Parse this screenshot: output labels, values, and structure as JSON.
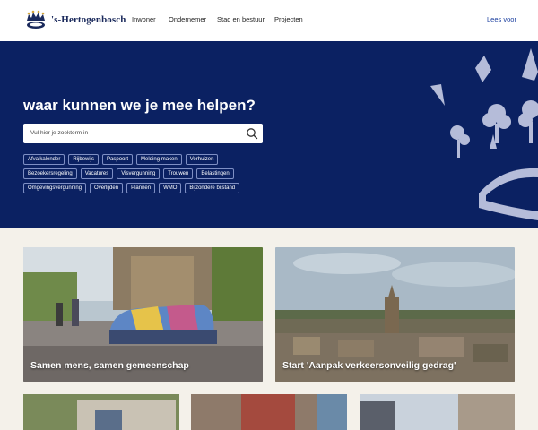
{
  "header": {
    "logo_icon": "crown-logo-icon",
    "brand": "'s-Hertogenbosch",
    "nav": [
      "Inwoner",
      "Ondernemer",
      "Stad en bestuur",
      "Projecten"
    ],
    "lees_voor": "Lees voor"
  },
  "hero": {
    "title": "waar kunnen we je mee helpen?",
    "search_placeholder": "Vul hier je zoekterm in",
    "search_icon": "search-icon",
    "tags_row1": [
      "Afvalkalender",
      "Rijbewijs",
      "Paspoort",
      "Melding maken",
      "Verhuizen"
    ],
    "tags_row2": [
      "Bezoekersregeling",
      "Vacatures",
      "Visvergunning",
      "Trouwen",
      "Belastingen"
    ],
    "tags_row3": [
      "Omgevingsvergunning",
      "Overlijden",
      "Plannen",
      "WMO",
      "Bijzondere bijstand"
    ]
  },
  "cards": [
    {
      "title": "Samen mens, samen gemeenschap"
    },
    {
      "title": "Start 'Aanpak verkeersonveilig gedrag'"
    }
  ],
  "colors": {
    "navy": "#0b2162",
    "background": "#f4f1ea",
    "link": "#1b3f9f"
  }
}
